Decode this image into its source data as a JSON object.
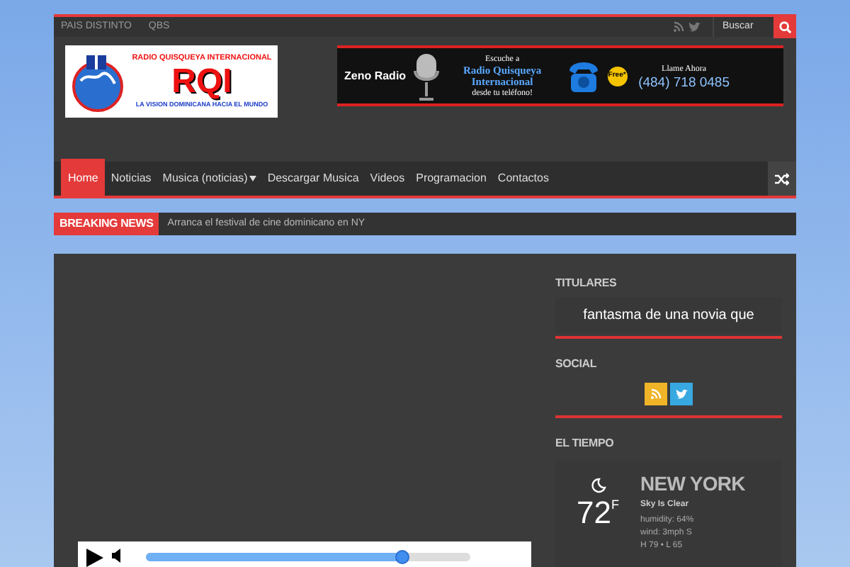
{
  "top_bar": {
    "links": [
      "PAIS DISTINTO",
      "QBS"
    ],
    "search": {
      "placeholder": "Buscar"
    }
  },
  "logo": {
    "title": "RADIO QUISQUEYA INTERNACIONAL",
    "acronym": "RQI",
    "slogan": "LA VISION DOMINICANA HACIA EL MUNDO"
  },
  "banner": {
    "brand": "Zeno Radio",
    "intro": "Escuche a",
    "station": "Radio Quisqueya Internacional",
    "subtitle": "desde tu teléfono!",
    "call_label": "Llame Ahora",
    "phone": "(484) 718 0485",
    "badge": "Free*"
  },
  "nav": {
    "items": [
      {
        "label": "Home",
        "selected": true,
        "dropdown": false
      },
      {
        "label": "Noticias",
        "selected": false,
        "dropdown": false
      },
      {
        "label": "Musica (noticias)",
        "selected": false,
        "dropdown": true
      },
      {
        "label": "Descargar Musica",
        "selected": false,
        "dropdown": false
      },
      {
        "label": "Videos",
        "selected": false,
        "dropdown": false
      },
      {
        "label": "Programacion",
        "selected": false,
        "dropdown": false
      },
      {
        "label": "Contactos",
        "selected": false,
        "dropdown": false
      }
    ]
  },
  "breaking_news": {
    "label": "BREAKING NEWS",
    "headline": "Arranca el festival de cine dominicano en NY"
  },
  "player": {
    "level": 0.79
  },
  "sidebar": {
    "titulares": {
      "title": "TITULARES",
      "text": "fantasma de una novia que"
    },
    "social": {
      "title": "SOCIAL"
    },
    "weather": {
      "title": "EL TIEMPO",
      "city": "NEW YORK",
      "condition": "Sky Is Clear",
      "temp": "72",
      "unit": "F",
      "humidity": "humidity: 64%",
      "wind": "wind: 3mph S",
      "range": "H 79 • L 65"
    }
  }
}
